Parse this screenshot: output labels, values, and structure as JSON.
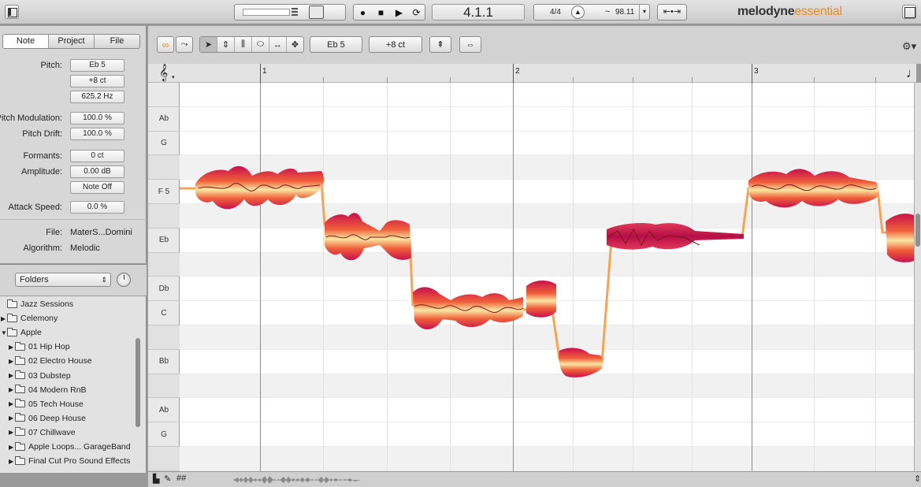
{
  "app": {
    "logo_main": "melodyne",
    "logo_edition": "essential"
  },
  "transport": {
    "position": "4.1.1",
    "time_signature": "4/4",
    "tempo_tilde": "~",
    "tempo": "98.11",
    "record_icon": "record-icon",
    "stop_icon": "stop-icon",
    "play_icon": "play-icon",
    "loop_icon": "loop-icon",
    "metronome_icon": "metronome-icon"
  },
  "inspector": {
    "tabs": [
      {
        "label": "Note",
        "active": true
      },
      {
        "label": "Project",
        "active": false
      },
      {
        "label": "File",
        "active": false
      }
    ],
    "pitch_label": "Pitch:",
    "pitch_note": "Eb 5",
    "pitch_cents": "+8 ct",
    "pitch_hz": "625.2 Hz",
    "pitch_modulation_label": "Pitch Modulation:",
    "pitch_modulation": "100.0 %",
    "pitch_drift_label": "Pitch Drift:",
    "pitch_drift": "100.0 %",
    "formants_label": "Formants:",
    "formants": "0 ct",
    "amplitude_label": "Amplitude:",
    "amplitude": "0.00 dB",
    "note_off": "Note Off",
    "attack_speed_label": "Attack Speed:",
    "attack_speed": "0.0 %",
    "file_label": "File:",
    "file": "MaterS...Domini",
    "algorithm_label": "Algorithm:",
    "algorithm": "Melodic"
  },
  "browser": {
    "select_value": "Folders",
    "folders": [
      {
        "label": "Jazz Sessions",
        "indent": 0,
        "arrow": ""
      },
      {
        "label": "Celemony",
        "indent": 0,
        "arrow": "▶"
      },
      {
        "label": "Apple",
        "indent": 0,
        "arrow": "▼"
      },
      {
        "label": "01 Hip Hop",
        "indent": 1,
        "arrow": "▶"
      },
      {
        "label": "02 Electro House",
        "indent": 1,
        "arrow": "▶"
      },
      {
        "label": "03 Dubstep",
        "indent": 1,
        "arrow": "▶"
      },
      {
        "label": "04 Modern RnB",
        "indent": 1,
        "arrow": "▶"
      },
      {
        "label": "05 Tech House",
        "indent": 1,
        "arrow": "▶"
      },
      {
        "label": "06 Deep House",
        "indent": 1,
        "arrow": "▶"
      },
      {
        "label": "07 Chillwave",
        "indent": 1,
        "arrow": "▶"
      },
      {
        "label": "Apple Loops... GarageBand",
        "indent": 1,
        "arrow": "▶"
      },
      {
        "label": "Final Cut Pro Sound Effects",
        "indent": 1,
        "arrow": "▶"
      }
    ]
  },
  "editor": {
    "pitch_field": "Eb 5",
    "cents_field": "+8 ct",
    "bars": [
      "1",
      "2",
      "3"
    ],
    "keys": [
      {
        "label": "",
        "black": false
      },
      {
        "label": "Ab",
        "black": false
      },
      {
        "label": "G",
        "black": false
      },
      {
        "label": "",
        "black": true
      },
      {
        "label": "F 5",
        "black": false
      },
      {
        "label": "",
        "black": true
      },
      {
        "label": "Eb",
        "black": false
      },
      {
        "label": "",
        "black": true
      },
      {
        "label": "Db",
        "black": false
      },
      {
        "label": "C",
        "black": false
      },
      {
        "label": "",
        "black": true
      },
      {
        "label": "Bb",
        "black": false
      },
      {
        "label": "",
        "black": true
      },
      {
        "label": "Ab",
        "black": false
      },
      {
        "label": "G",
        "black": false
      },
      {
        "label": "",
        "black": true
      }
    ],
    "colors": {
      "blob_hot": "#c8104e",
      "blob_mid": "#f0603a",
      "blob_light": "#fbe6a2",
      "pitch_line": "#f5a355",
      "accent": "#f08a22"
    }
  }
}
